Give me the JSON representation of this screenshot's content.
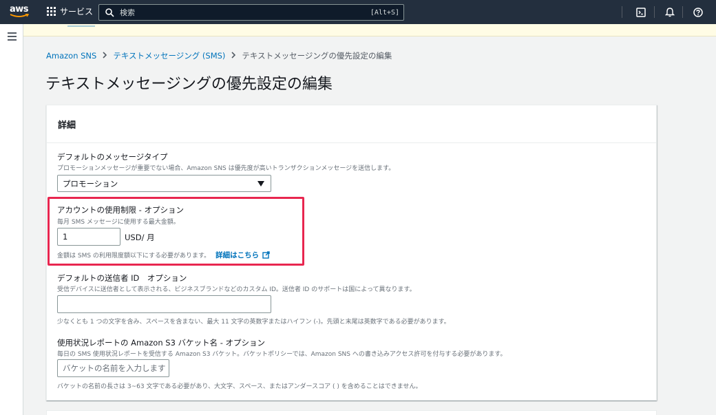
{
  "topnav": {
    "logo_text": "aws",
    "services_label": "サービス",
    "search_placeholder": "検索",
    "search_shortcut": "[Alt+S]"
  },
  "breadcrumb": {
    "items": [
      "Amazon SNS",
      "テキストメッセージング (SMS)",
      "テキストメッセージングの優先設定の編集"
    ]
  },
  "page_title": "テキストメッセージングの優先設定の編集",
  "container": {
    "title": "詳細",
    "message_type": {
      "label": "デフォルトのメッセージタイプ",
      "description": "プロモーションメッセージが重要でない場合、Amazon SNS は優先度が高いトランザクションメッセージを送信します。",
      "selected": "プロモーション"
    },
    "spend_limit": {
      "label": "アカウントの使用制限 - オプション",
      "description": "毎月 SMS メッセージに使用する最大金額。",
      "value": "1",
      "unit": "USD/ 月",
      "hint": "金額は SMS の利用限度額以下にする必要があります。",
      "link": "詳細はこちら"
    },
    "sender_id": {
      "label": "デフォルトの送信者 ID　オプション",
      "description": "受信デバイスに送信者として表示される、ビジネスブランドなどのカスタム ID。送信者 ID のサポートは国によって異なります。",
      "value": "",
      "hint": "少なくとも 1 つの文字を含み、スペースを含まない、最大 11 文字の英数字またはハイフン (-)。先頭と末尾は英数字である必要があります。"
    },
    "bucket": {
      "label": "使用状況レポートの Amazon S3 バケット名 - オプション",
      "description": "毎日の SMS 使用状況レポートを受信する Amazon S3 バケット。バケットポリシーでは、Amazon SNS への書き込みアクセス許可を付与する必要があります。",
      "placeholder": "バケットの名前を入力します",
      "hint": "バケットの名前の長さは 3~63 文字である必要があり、大文字、スペース、またはアンダースコア ( ) を含めることはできません。"
    }
  },
  "colors": {
    "nav_bg": "#232f3e",
    "link": "#0073bb",
    "highlight": "#e8264f"
  }
}
